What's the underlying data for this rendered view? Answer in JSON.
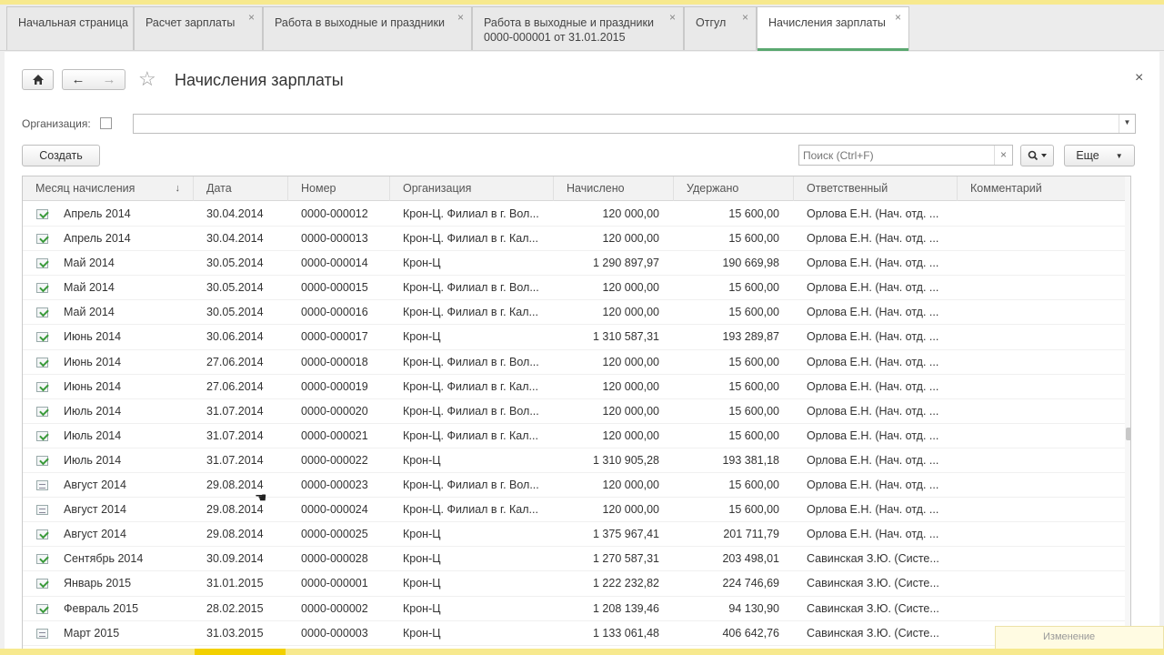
{
  "tabs": [
    {
      "label": "Начальная страница",
      "closable": false
    },
    {
      "label": "Расчет зарплаты",
      "closable": true
    },
    {
      "label": "Работа в выходные и праздники",
      "closable": true
    },
    {
      "label": "Работа в выходные и праздники 0000-000001 от 31.01.2015",
      "closable": true
    },
    {
      "label": "Отгул",
      "closable": true
    },
    {
      "label": "Начисления зарплаты",
      "closable": true,
      "active": true
    }
  ],
  "header": {
    "title": "Начисления зарплаты"
  },
  "filter": {
    "org_label": "Организация:",
    "org_value": ""
  },
  "toolbar": {
    "create_label": "Создать",
    "search_placeholder": "Поиск (Ctrl+F)",
    "more_label": "Еще"
  },
  "table": {
    "columns": [
      "Месяц начисления",
      "Дата",
      "Номер",
      "Организация",
      "Начислено",
      "Удержано",
      "Ответственный",
      "Комментарий"
    ],
    "rows": [
      {
        "icon": "posted",
        "month": "Апрель 2014",
        "date": "30.04.2014",
        "num": "0000-000012",
        "org": "Крон-Ц. Филиал в г. Вол...",
        "accr": "120 000,00",
        "ded": "15 600,00",
        "resp": "Орлова Е.Н. (Нач. отд. ...",
        "comment": ""
      },
      {
        "icon": "posted",
        "month": "Апрель 2014",
        "date": "30.04.2014",
        "num": "0000-000013",
        "org": "Крон-Ц. Филиал в г. Кал...",
        "accr": "120 000,00",
        "ded": "15 600,00",
        "resp": "Орлова Е.Н. (Нач. отд. ...",
        "comment": ""
      },
      {
        "icon": "posted",
        "month": "Май 2014",
        "date": "30.05.2014",
        "num": "0000-000014",
        "org": "Крон-Ц",
        "accr": "1 290 897,97",
        "ded": "190 669,98",
        "resp": "Орлова Е.Н. (Нач. отд. ...",
        "comment": ""
      },
      {
        "icon": "posted",
        "month": "Май 2014",
        "date": "30.05.2014",
        "num": "0000-000015",
        "org": "Крон-Ц. Филиал в г. Вол...",
        "accr": "120 000,00",
        "ded": "15 600,00",
        "resp": "Орлова Е.Н. (Нач. отд. ...",
        "comment": ""
      },
      {
        "icon": "posted",
        "month": "Май 2014",
        "date": "30.05.2014",
        "num": "0000-000016",
        "org": "Крон-Ц. Филиал в г. Кал...",
        "accr": "120 000,00",
        "ded": "15 600,00",
        "resp": "Орлова Е.Н. (Нач. отд. ...",
        "comment": ""
      },
      {
        "icon": "posted",
        "month": "Июнь 2014",
        "date": "30.06.2014",
        "num": "0000-000017",
        "org": "Крон-Ц",
        "accr": "1 310 587,31",
        "ded": "193 289,87",
        "resp": "Орлова Е.Н. (Нач. отд. ...",
        "comment": ""
      },
      {
        "icon": "posted",
        "month": "Июнь 2014",
        "date": "27.06.2014",
        "num": "0000-000018",
        "org": "Крон-Ц. Филиал в г. Вол...",
        "accr": "120 000,00",
        "ded": "15 600,00",
        "resp": "Орлова Е.Н. (Нач. отд. ...",
        "comment": ""
      },
      {
        "icon": "posted",
        "month": "Июнь 2014",
        "date": "27.06.2014",
        "num": "0000-000019",
        "org": "Крон-Ц. Филиал в г. Кал...",
        "accr": "120 000,00",
        "ded": "15 600,00",
        "resp": "Орлова Е.Н. (Нач. отд. ...",
        "comment": ""
      },
      {
        "icon": "posted",
        "month": "Июль 2014",
        "date": "31.07.2014",
        "num": "0000-000020",
        "org": "Крон-Ц. Филиал в г. Вол...",
        "accr": "120 000,00",
        "ded": "15 600,00",
        "resp": "Орлова Е.Н. (Нач. отд. ...",
        "comment": ""
      },
      {
        "icon": "posted",
        "month": "Июль 2014",
        "date": "31.07.2014",
        "num": "0000-000021",
        "org": "Крон-Ц. Филиал в г. Кал...",
        "accr": "120 000,00",
        "ded": "15 600,00",
        "resp": "Орлова Е.Н. (Нач. отд. ...",
        "comment": ""
      },
      {
        "icon": "posted",
        "month": "Июль 2014",
        "date": "31.07.2014",
        "num": "0000-000022",
        "org": "Крон-Ц",
        "accr": "1 310 905,28",
        "ded": "193 381,18",
        "resp": "Орлова Е.Н. (Нач. отд. ...",
        "comment": ""
      },
      {
        "icon": "draft",
        "month": "Август 2014",
        "date": "29.08.2014",
        "num": "0000-000023",
        "org": "Крон-Ц. Филиал в г. Вол...",
        "accr": "120 000,00",
        "ded": "15 600,00",
        "resp": "Орлова Е.Н. (Нач. отд. ...",
        "comment": ""
      },
      {
        "icon": "draft",
        "month": "Август 2014",
        "date": "29.08.2014",
        "num": "0000-000024",
        "org": "Крон-Ц. Филиал в г. Кал...",
        "accr": "120 000,00",
        "ded": "15 600,00",
        "resp": "Орлова Е.Н. (Нач. отд. ...",
        "comment": ""
      },
      {
        "icon": "posted",
        "month": "Август 2014",
        "date": "29.08.2014",
        "num": "0000-000025",
        "org": "Крон-Ц",
        "accr": "1 375 967,41",
        "ded": "201 711,79",
        "resp": "Орлова Е.Н. (Нач. отд. ...",
        "comment": ""
      },
      {
        "icon": "posted",
        "month": "Сентябрь 2014",
        "date": "30.09.2014",
        "num": "0000-000028",
        "org": "Крон-Ц",
        "accr": "1 270 587,31",
        "ded": "203 498,01",
        "resp": "Савинская З.Ю. (Систе...",
        "comment": ""
      },
      {
        "icon": "posted",
        "month": "Январь 2015",
        "date": "31.01.2015",
        "num": "0000-000001",
        "org": "Крон-Ц",
        "accr": "1 222 232,82",
        "ded": "224 746,69",
        "resp": "Савинская З.Ю. (Систе...",
        "comment": ""
      },
      {
        "icon": "posted",
        "month": "Февраль 2015",
        "date": "28.02.2015",
        "num": "0000-000002",
        "org": "Крон-Ц",
        "accr": "1 208 139,46",
        "ded": "94 130,90",
        "resp": "Савинская З.Ю. (Систе...",
        "comment": ""
      },
      {
        "icon": "draft",
        "month": "Март 2015",
        "date": "31.03.2015",
        "num": "0000-000003",
        "org": "Крон-Ц",
        "accr": "1 133 061,48",
        "ded": "406 642,76",
        "resp": "Савинская З.Ю. (Систе...",
        "comment": ""
      }
    ]
  },
  "notification": {
    "text": "Изменение"
  },
  "colors": {
    "accent": "#5aa870",
    "strip": "#f7e98e"
  }
}
